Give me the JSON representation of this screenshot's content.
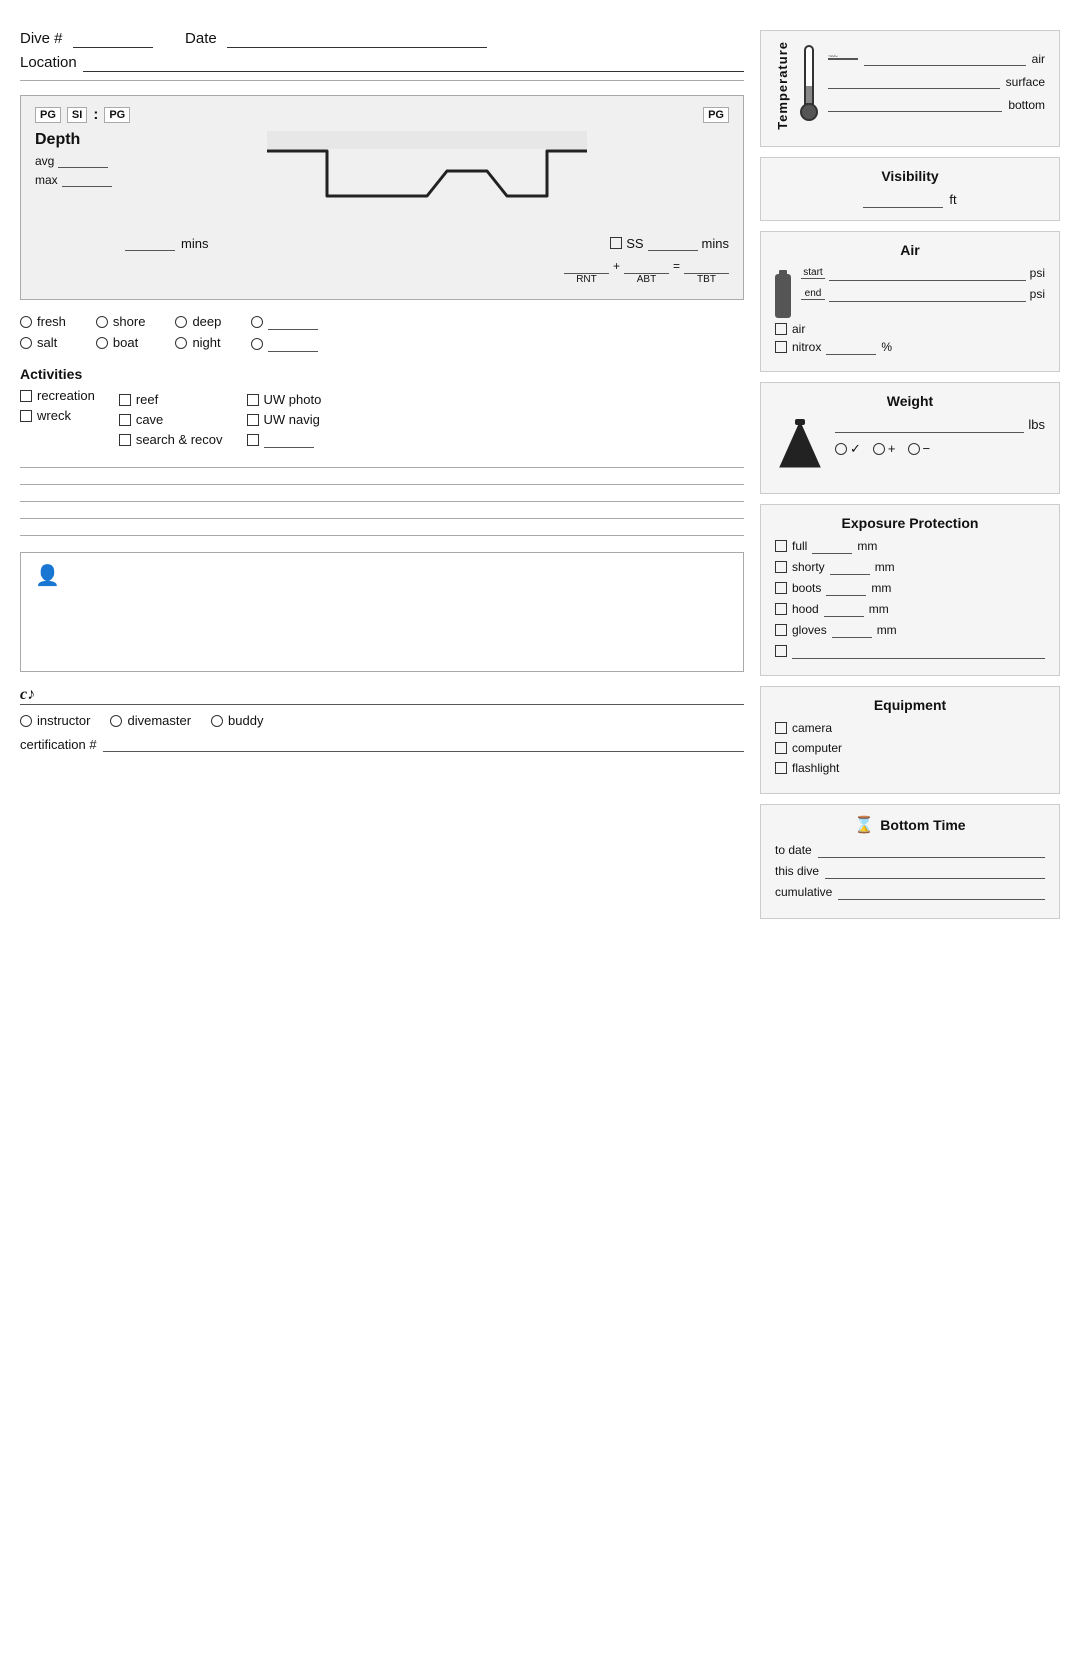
{
  "header": {
    "dive_label": "Dive #",
    "date_label": "Date",
    "location_label": "Location"
  },
  "profile": {
    "pg_label_1": "PG",
    "si_label": "SI",
    "pg_label_2": "PG",
    "pg_label_3": "PG",
    "depth_title": "Depth",
    "avg_label": "avg",
    "max_label": "max",
    "mins_label": "mins",
    "ss_label": "SS",
    "ss_mins_label": "mins",
    "rnt_label": "RNT",
    "abt_label": "ABT",
    "tbt_label": "TBT",
    "plus_sign": "+",
    "equals_sign": "="
  },
  "water_type": {
    "fresh_label": "fresh",
    "salt_label": "salt"
  },
  "entry_type": {
    "shore_label": "shore",
    "boat_label": "boat"
  },
  "dive_type": {
    "deep_label": "deep",
    "night_label": "night"
  },
  "activities": {
    "title": "Activities",
    "items": [
      {
        "label": "recreation"
      },
      {
        "label": "wreck"
      }
    ],
    "col2": [
      {
        "label": "reef"
      },
      {
        "label": "cave"
      },
      {
        "label": "search & recov"
      }
    ],
    "col3": [
      {
        "label": "UW photo"
      },
      {
        "label": "UW navig"
      },
      {
        "label": ""
      }
    ]
  },
  "temperature": {
    "title": "Temperature",
    "air_label": "air",
    "surface_label": "surface",
    "bottom_label": "bottom"
  },
  "visibility": {
    "title": "Visibility",
    "ft_label": "ft"
  },
  "air": {
    "title": "Air",
    "start_label": "start",
    "end_label": "end",
    "psi_label": "psi",
    "air_label": "air",
    "nitrox_label": "nitrox",
    "nitrox_pct": "%"
  },
  "weight": {
    "title": "Weight",
    "lbs_label": "lbs",
    "check_label": "✓",
    "plus_label": "+",
    "minus_label": "−"
  },
  "exposure": {
    "title": "Exposure Protection",
    "items": [
      {
        "label": "full",
        "unit": "mm"
      },
      {
        "label": "shorty",
        "unit": "mm"
      },
      {
        "label": "boots",
        "unit": "mm"
      },
      {
        "label": "hood",
        "unit": "mm"
      },
      {
        "label": "gloves",
        "unit": "mm"
      }
    ]
  },
  "equipment": {
    "title": "Equipment",
    "items": [
      {
        "label": "camera"
      },
      {
        "label": "computer"
      },
      {
        "label": "flashlight"
      }
    ]
  },
  "bottom_time": {
    "title": "Bottom Time",
    "to_date_label": "to date",
    "this_dive_label": "this dive",
    "cumulative_label": "cumulative"
  },
  "buddy": {
    "sig_char": "c♪",
    "instructor_label": "instructor",
    "divemaster_label": "divemaster",
    "buddy_label": "buddy",
    "cert_label": "certification #"
  },
  "notes_lines": 5
}
